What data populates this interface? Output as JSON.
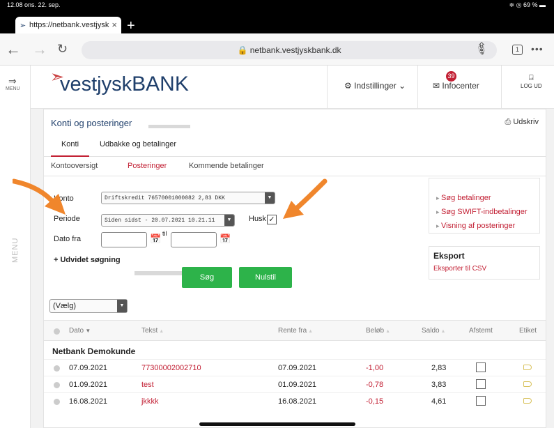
{
  "status": {
    "time": "12.08  ons. 22. sep.",
    "battery": "≑ ◎ 69 % ▬"
  },
  "browser": {
    "tab_title": "https://netbank.vestjysk",
    "url": "🔒 netbank.vestjyskbank.dk",
    "tab_count": "1"
  },
  "sidemenu": {
    "label_top": "MENU",
    "label_vertical": "MENU"
  },
  "header": {
    "logo_main": "vestjysk",
    "logo_bank": "BANK",
    "settings_label": "Indstillinger ⌄",
    "infocenter_label": "Infocenter",
    "infocenter_badge": "39",
    "logout_label": "LOG UD"
  },
  "page": {
    "title": "Konti og posteringer",
    "print_label": "Udskriv",
    "tabs": [
      "Konti",
      "Udbakke og betalinger"
    ],
    "subtabs": [
      "Kontooversigt",
      "Posteringer",
      "Kommende betalinger"
    ]
  },
  "form": {
    "konto_label": "Konto",
    "konto_value": "Driftskredit 76570001000082 2,83 DKK",
    "periode_label": "Periode",
    "periode_value": "Siden sidst - 20.07.2021 10.21.11",
    "husk_label": "Husk",
    "husk_check": "✓",
    "dato_fra_label": "Dato fra",
    "til_label": "til",
    "udvidet_label": "+ Udvidet søgning",
    "search_button": "Søg",
    "reset_button": "Nulstil",
    "vaelg_label": "(Vælg)"
  },
  "side_links": [
    "Søg betalinger",
    "Søg SWIFT-indbetalinger",
    "Visning af posteringer"
  ],
  "export": {
    "heading": "Eksport",
    "link": "Eksporter til CSV"
  },
  "table": {
    "headers": [
      "Dato",
      "Tekst",
      "Rente fra",
      "Beløb",
      "Saldo",
      "Afstemt",
      "Etiket"
    ],
    "group": "Netbank Demokunde",
    "rows": [
      {
        "dato": "07.09.2021",
        "tekst": "77300002002710",
        "rente_fra": "07.09.2021",
        "beloeb": "-1,00",
        "saldo": "2,83"
      },
      {
        "dato": "01.09.2021",
        "tekst": "test",
        "rente_fra": "01.09.2021",
        "beloeb": "-0,78",
        "saldo": "3,83"
      },
      {
        "dato": "16.08.2021",
        "tekst": "jkkkk",
        "rente_fra": "16.08.2021",
        "beloeb": "-0,15",
        "saldo": "4,61"
      }
    ]
  },
  "colors": {
    "brand_blue": "#1f3f6b",
    "accent_red": "#c21f33",
    "button_green": "#2db34a",
    "annotation_orange": "#f0862c"
  }
}
